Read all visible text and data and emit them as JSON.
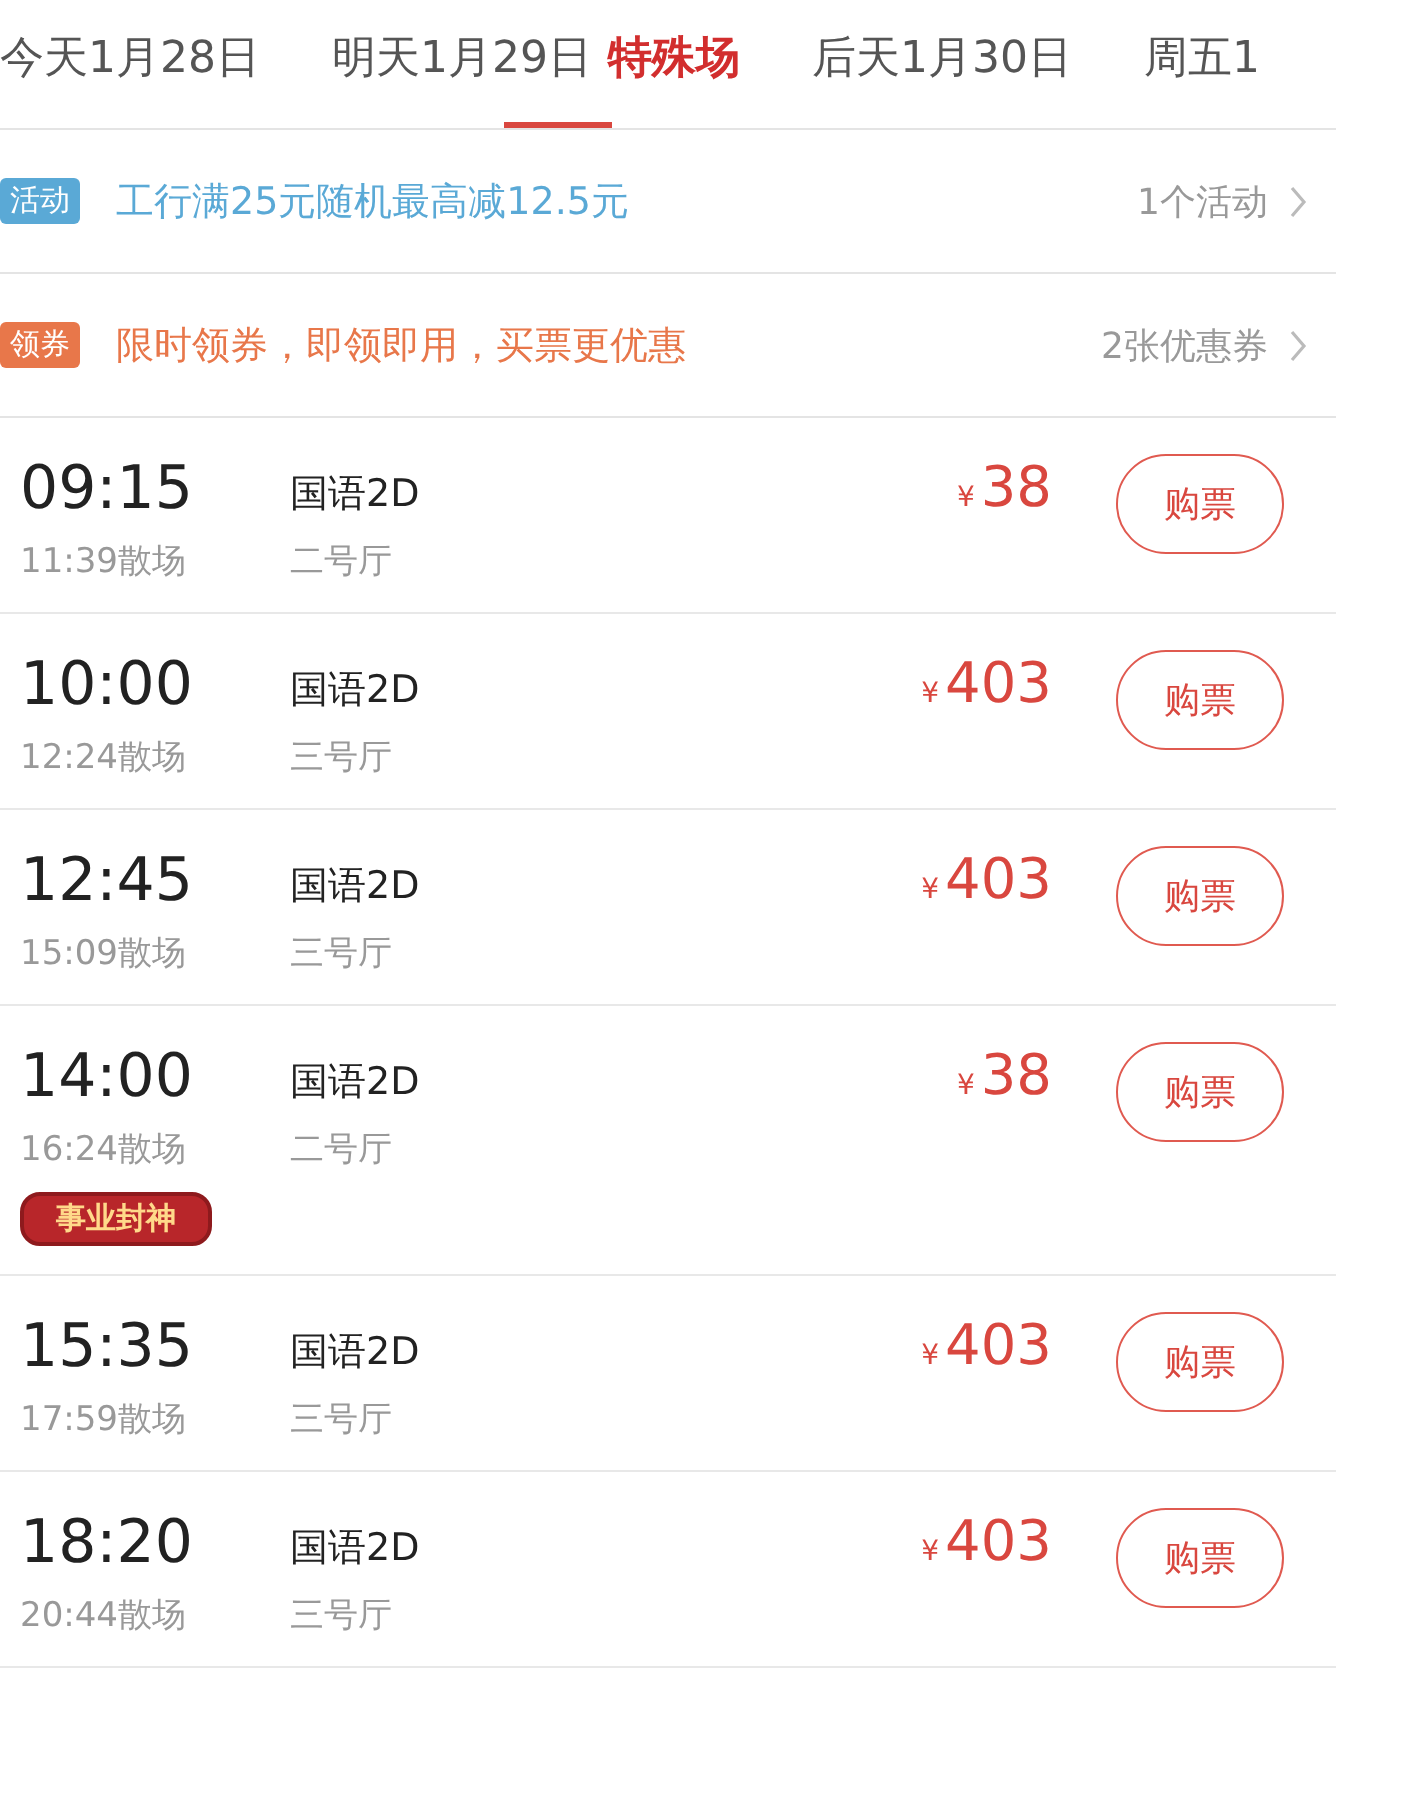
{
  "tabs": [
    {
      "label": "今天1月28日",
      "selected": false
    },
    {
      "label": "明天1月29日",
      "tag": "特殊场",
      "selected": true
    },
    {
      "label": "后天1月30日",
      "selected": false
    },
    {
      "label": "周五1",
      "selected": false
    }
  ],
  "promos": [
    {
      "kind": "activity",
      "badge": "活动",
      "text": "工行满25元随机最高减12.5元",
      "link": "1个活动"
    },
    {
      "kind": "coupon",
      "badge": "领券",
      "text": "限时领券，即领即用，买票更优惠",
      "link": "2张优惠券"
    }
  ],
  "showtimes": [
    {
      "start": "09:15",
      "end": "11:39散场",
      "language": "国语2D",
      "hall": "二号厅",
      "currency": "¥",
      "price": "38",
      "button": "购票"
    },
    {
      "start": "10:00",
      "end": "12:24散场",
      "language": "国语2D",
      "hall": "三号厅",
      "currency": "¥",
      "price": "403",
      "button": "购票"
    },
    {
      "start": "12:45",
      "end": "15:09散场",
      "language": "国语2D",
      "hall": "三号厅",
      "currency": "¥",
      "price": "403",
      "button": "购票"
    },
    {
      "start": "14:00",
      "end": "16:24散场",
      "language": "国语2D",
      "hall": "二号厅",
      "currency": "¥",
      "price": "38",
      "button": "购票",
      "badge": "事业封神"
    },
    {
      "start": "15:35",
      "end": "17:59散场",
      "language": "国语2D",
      "hall": "三号厅",
      "currency": "¥",
      "price": "403",
      "button": "购票"
    },
    {
      "start": "18:20",
      "end": "20:44散场",
      "language": "国语2D",
      "hall": "三号厅",
      "currency": "¥",
      "price": "403",
      "button": "购票"
    }
  ]
}
